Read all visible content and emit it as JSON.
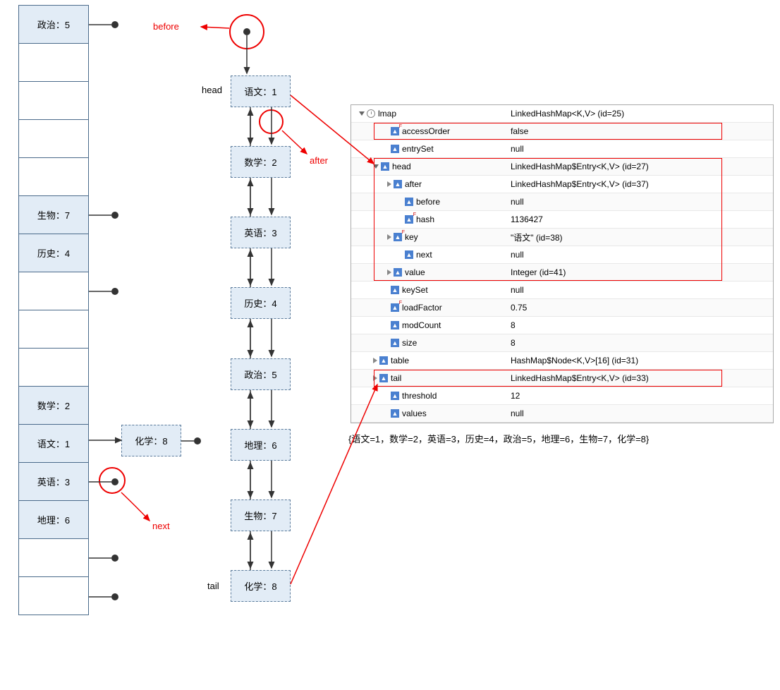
{
  "hash_table": {
    "indices": [
      "0",
      "5",
      "6",
      "10",
      "11",
      "12",
      "13"
    ],
    "slots": [
      {
        "index": 0,
        "text": "政治：5"
      },
      {
        "index": 5,
        "text": "生物：7"
      },
      {
        "index": 6,
        "text": "历史：4"
      },
      {
        "index": 10,
        "text": "数学：2"
      },
      {
        "index": 11,
        "text": "语文：1"
      },
      {
        "index": 12,
        "text": "英语：3"
      },
      {
        "index": 13,
        "text": "地理：6"
      }
    ],
    "bucket_extra": {
      "text": "化学：8"
    }
  },
  "chain": {
    "head_label": "head",
    "tail_label": "tail",
    "before_label": "before",
    "after_label": "after",
    "next_label": "next",
    "nodes": [
      "语文：1",
      "数学：2",
      "英语：3",
      "历史：4",
      "政治：5",
      "地理：6",
      "生物：7",
      "化学：8"
    ]
  },
  "debugger": {
    "rows": [
      {
        "indent": 0,
        "tri": "open",
        "icon": "clock",
        "name": "lmap",
        "val": "LinkedHashMap<K,V>  (id=25)"
      },
      {
        "indent": 1,
        "tri": "none",
        "icon": "fsup",
        "name": "accessOrder",
        "val": "false"
      },
      {
        "indent": 1,
        "tri": "none",
        "icon": "f",
        "name": "entrySet",
        "val": "null"
      },
      {
        "indent": 1,
        "tri": "open",
        "icon": "f",
        "name": "head",
        "val": "LinkedHashMap$Entry<K,V>  (id=27)"
      },
      {
        "indent": 2,
        "tri": "closed",
        "icon": "f",
        "name": "after",
        "val": "LinkedHashMap$Entry<K,V>  (id=37)"
      },
      {
        "indent": 2,
        "tri": "none",
        "icon": "f",
        "name": "before",
        "val": "null"
      },
      {
        "indent": 2,
        "tri": "none",
        "icon": "fsup",
        "name": "hash",
        "val": "1136427"
      },
      {
        "indent": 2,
        "tri": "closed",
        "icon": "fsup",
        "name": "key",
        "val": "\"语文\" (id=38)"
      },
      {
        "indent": 2,
        "tri": "none",
        "icon": "f",
        "name": "next",
        "val": "null"
      },
      {
        "indent": 2,
        "tri": "closed",
        "icon": "f",
        "name": "value",
        "val": "Integer  (id=41)"
      },
      {
        "indent": 1,
        "tri": "none",
        "icon": "f",
        "name": "keySet",
        "val": "null"
      },
      {
        "indent": 1,
        "tri": "none",
        "icon": "fsup",
        "name": "loadFactor",
        "val": "0.75"
      },
      {
        "indent": 1,
        "tri": "none",
        "icon": "f",
        "name": "modCount",
        "val": "8"
      },
      {
        "indent": 1,
        "tri": "none",
        "icon": "f",
        "name": "size",
        "val": "8"
      },
      {
        "indent": 1,
        "tri": "closed",
        "icon": "f",
        "name": "table",
        "val": "HashMap$Node<K,V>[16]  (id=31)"
      },
      {
        "indent": 1,
        "tri": "closed",
        "icon": "f",
        "name": "tail",
        "val": "LinkedHashMap$Entry<K,V>  (id=33)"
      },
      {
        "indent": 1,
        "tri": "none",
        "icon": "f",
        "name": "threshold",
        "val": "12"
      },
      {
        "indent": 1,
        "tri": "none",
        "icon": "f",
        "name": "values",
        "val": "null"
      }
    ]
  },
  "tostring": "{语文=1，数学=2，英语=3，历史=4，政治=5，地理=6，生物=7，化学=8}"
}
